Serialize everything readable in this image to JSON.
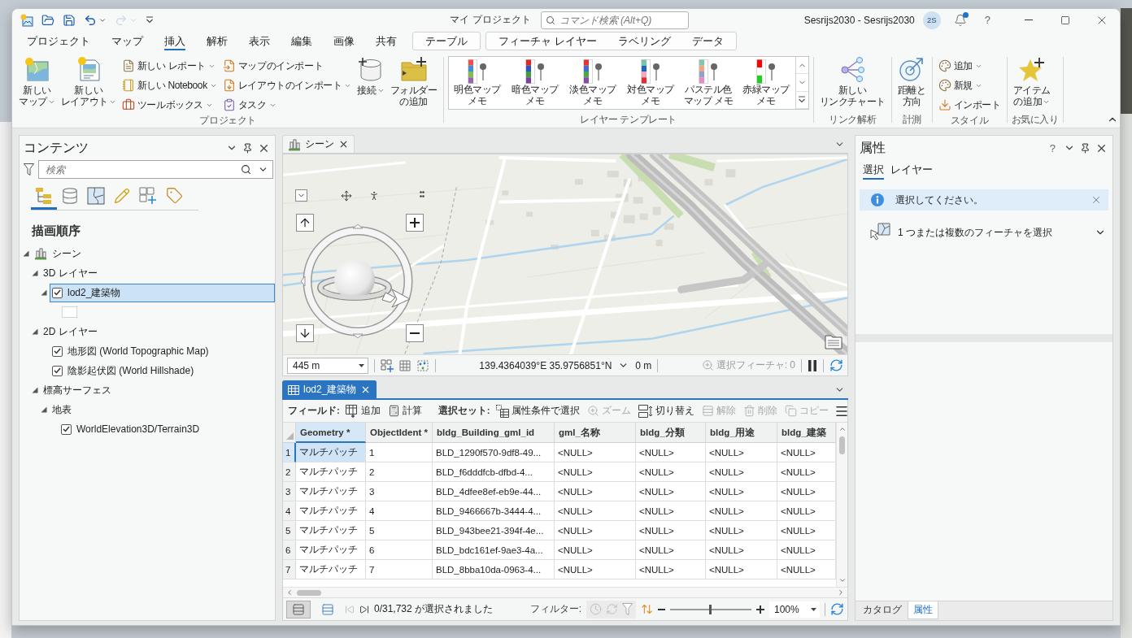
{
  "title_bar": {
    "quick_access": [
      {
        "kind": "new",
        "disabled": false
      },
      {
        "kind": "open",
        "disabled": false
      },
      {
        "kind": "save",
        "disabled": false
      },
      {
        "kind": "undo",
        "disabled": false
      },
      {
        "kind": "redo",
        "disabled": true
      },
      {
        "kind": "customize",
        "disabled": false
      }
    ],
    "title": "マイ プロジェクト",
    "command_search": {
      "placeholder": "コマンド検索 (Alt+Q)"
    },
    "user": "Sesrijs2030 - Sesrijs2030",
    "avatar": "2S",
    "notification_dot": true,
    "help": "?"
  },
  "ribbon": {
    "tabs": [
      {
        "label": "プロジェクト",
        "selected": false
      },
      {
        "label": "マップ",
        "selected": false
      },
      {
        "label": "挿入",
        "selected": true
      },
      {
        "label": "解析",
        "selected": false
      },
      {
        "label": "表示",
        "selected": false
      },
      {
        "label": "編集",
        "selected": false
      },
      {
        "label": "画像",
        "selected": false
      },
      {
        "label": "共有",
        "selected": false
      }
    ],
    "context_tabs": [
      {
        "tabs": [
          {
            "label": "テーブル",
            "selected": false
          }
        ]
      },
      {
        "tabs": [
          {
            "label": "フィーチャ レイヤー",
            "selected": false
          },
          {
            "label": "ラベリング",
            "selected": false
          },
          {
            "label": "データ",
            "selected": false
          }
        ]
      }
    ],
    "groups": [
      {
        "label": "プロジェクト",
        "controls": [
          {
            "kind": "large",
            "lines": [
              "新しい",
              "マップ"
            ],
            "dropdown": true
          },
          {
            "kind": "large",
            "lines": [
              "新しい",
              "レイアウト"
            ],
            "dropdown": true
          },
          {
            "kind": "stack",
            "buttons": [
              {
                "label": "新しい レポート",
                "dropdown": true
              },
              {
                "label": "新しい Notebook",
                "dropdown": true
              },
              {
                "label": "ツールボックス",
                "dropdown": true
              }
            ]
          },
          {
            "kind": "stack",
            "buttons": [
              {
                "label": "マップのインポート",
                "dropdown": false
              },
              {
                "label": "レイアウトのインポート",
                "dropdown": true
              },
              {
                "label": "タスク",
                "dropdown": true
              }
            ]
          },
          {
            "kind": "large",
            "lines": [
              "接続"
            ],
            "dropdown": true
          },
          {
            "kind": "large",
            "lines": [
              "フォルダー",
              "の追加"
            ],
            "dropdown": false
          }
        ]
      },
      {
        "label": "レイヤー テンプレート",
        "controls": [
          {
            "kind": "gallery",
            "items": [
              {
                "lines": [
                  "明色マップ",
                  "メモ"
                ]
              },
              {
                "lines": [
                  "暗色マップ",
                  "メモ"
                ]
              },
              {
                "lines": [
                  "淡色マップ",
                  "メモ"
                ]
              },
              {
                "lines": [
                  "対色マップ",
                  "メモ"
                ]
              },
              {
                "lines": [
                  "パステル色",
                  "マップ メモ"
                ]
              },
              {
                "lines": [
                  "赤緑マップ",
                  "メモ"
                ]
              }
            ]
          }
        ]
      },
      {
        "label": "リンク解析",
        "controls": [
          {
            "kind": "large",
            "lines": [
              "新しい",
              "リンクチャート"
            ],
            "dropdown": false
          }
        ]
      },
      {
        "label": "計測",
        "controls": [
          {
            "kind": "large",
            "lines": [
              "距離と",
              "方向"
            ],
            "dropdown": false
          }
        ]
      },
      {
        "label": "スタイル",
        "controls": [
          {
            "kind": "stack",
            "buttons": [
              {
                "label": "追加",
                "dropdown": true
              },
              {
                "label": "新規",
                "dropdown": true
              },
              {
                "label": "インポート",
                "dropdown": false
              }
            ]
          }
        ]
      },
      {
        "label": "お気に入り",
        "controls": [
          {
            "kind": "large",
            "lines": [
              "アイテム",
              "の追加"
            ],
            "dropdown": true
          }
        ]
      }
    ]
  },
  "contents_pane": {
    "title": "コンテンツ",
    "search": {
      "placeholder": "検索"
    },
    "view_tabs": [
      {
        "selected": true
      },
      {
        "selected": false
      },
      {
        "selected": false
      },
      {
        "selected": false
      },
      {
        "selected": false
      },
      {
        "selected": false
      }
    ],
    "heading": "描画順序",
    "tree": [
      {
        "kind": "scene",
        "label": "シーン",
        "expanded": true,
        "selected": false,
        "children": [
          {
            "kind": "group",
            "label": "3D レイヤー",
            "expanded": true,
            "selected": false,
            "children": [
              {
                "kind": "layer",
                "label": "lod2_建築物",
                "expanded": true,
                "checked": true,
                "selected": true,
                "children": [
                  {
                    "kind": "symbol",
                    "selected": false
                  }
                ]
              }
            ]
          },
          {
            "kind": "group",
            "label": "2D レイヤー",
            "expanded": true,
            "selected": false,
            "children": [
              {
                "kind": "layer",
                "label": "地形図 (World Topographic Map)",
                "checked": true,
                "selected": false
              },
              {
                "kind": "layer",
                "label": "陰影起伏図 (World Hillshade)",
                "checked": true,
                "selected": false
              }
            ]
          },
          {
            "kind": "group",
            "label": "標高サーフェス",
            "expanded": true,
            "selected": false,
            "children": [
              {
                "kind": "group",
                "label": "地表",
                "expanded": true,
                "selected": false,
                "children": [
                  {
                    "kind": "layer",
                    "label": "WorldElevation3D/Terrain3D",
                    "checked": true,
                    "selected": false
                  }
                ]
              }
            ]
          }
        ]
      }
    ]
  },
  "scene_view": {
    "active": false,
    "tab": {
      "label": "シーン",
      "selected": true
    },
    "scale": "445 m",
    "coordinates": "139.4364039°E 35.9756851°N",
    "elevation": "0 m",
    "selected_features": "選択フィーチャ: 0"
  },
  "table_view": {
    "active": true,
    "tab": {
      "label": "lod2_建築物",
      "selected": true
    },
    "toolbar": [
      {
        "kind": "label",
        "text": "フィールド:"
      },
      {
        "kind": "button",
        "label": "追加",
        "disabled": false
      },
      {
        "kind": "button",
        "label": "計算",
        "disabled": false
      },
      {
        "kind": "separator"
      },
      {
        "kind": "label",
        "text": "選択セット:"
      },
      {
        "kind": "button",
        "label": "属性条件で選択",
        "disabled": false
      },
      {
        "kind": "button",
        "label": "ズーム",
        "disabled": true
      },
      {
        "kind": "button",
        "label": "切り替え",
        "disabled": false
      },
      {
        "kind": "button",
        "label": "解除",
        "disabled": true
      },
      {
        "kind": "button",
        "label": "削除",
        "disabled": true
      },
      {
        "kind": "button",
        "label": "コピー",
        "disabled": true
      }
    ],
    "columns": [
      {
        "label": "Geometry *",
        "current": true
      },
      {
        "label": "ObjectIdent *",
        "current": false
      },
      {
        "label": "bldg_Building_gml_id",
        "current": false
      },
      {
        "label": "gml_名称",
        "current": false
      },
      {
        "label": "bldg_分類",
        "current": false
      },
      {
        "label": "bldg_用途",
        "current": false
      },
      {
        "label": "bldg_建築",
        "current": false
      }
    ],
    "rows": [
      {
        "number": "1",
        "current": true,
        "selected": false,
        "cells": [
          "マルチパッチ",
          "1",
          "BLD_1290f570-9df8-49...",
          "<NULL>",
          "<NULL>",
          "<NULL>",
          "<NULL>"
        ]
      },
      {
        "number": "2",
        "current": false,
        "selected": false,
        "cells": [
          "マルチパッチ",
          "2",
          "BLD_f6dddfcb-dfbd-4...",
          "<NULL>",
          "<NULL>",
          "<NULL>",
          "<NULL>"
        ]
      },
      {
        "number": "3",
        "current": false,
        "selected": false,
        "cells": [
          "マルチパッチ",
          "3",
          "BLD_4dfee8ef-eb9e-44...",
          "<NULL>",
          "<NULL>",
          "<NULL>",
          "<NULL>"
        ]
      },
      {
        "number": "4",
        "current": false,
        "selected": false,
        "cells": [
          "マルチパッチ",
          "4",
          "BLD_9466667b-3444-4...",
          "<NULL>",
          "<NULL>",
          "<NULL>",
          "<NULL>"
        ]
      },
      {
        "number": "5",
        "current": false,
        "selected": false,
        "cells": [
          "マルチパッチ",
          "5",
          "BLD_943bee21-394f-4e...",
          "<NULL>",
          "<NULL>",
          "<NULL>",
          "<NULL>"
        ]
      },
      {
        "number": "6",
        "current": false,
        "selected": false,
        "cells": [
          "マルチパッチ",
          "6",
          "BLD_bdc161ef-9ae3-4a...",
          "<NULL>",
          "<NULL>",
          "<NULL>",
          "<NULL>"
        ]
      },
      {
        "number": "7",
        "current": false,
        "selected": false,
        "cells": [
          "マルチパッチ",
          "7",
          "BLD_8bba10da-0963-4...",
          "<NULL>",
          "<NULL>",
          "<NULL>",
          "<NULL>"
        ]
      }
    ],
    "record_views": [
      {
        "selected": true
      },
      {
        "selected": false
      }
    ],
    "selection_status": "0/31,732 が選択されました",
    "filter_label": "フィルター:",
    "zoom": {
      "level": 0.49,
      "reading": "100%"
    }
  },
  "properties_pane": {
    "title": "属性",
    "help": "?",
    "tabs": [
      {
        "label": "選択",
        "selected": true
      },
      {
        "label": "レイヤー",
        "selected": false
      }
    ],
    "message": "選択してください。",
    "hint": "1 つまたは複数のフィーチャを選択",
    "hint_expanded": false,
    "bottom_tabs": [
      {
        "label": "カタログ",
        "selected": false
      },
      {
        "label": "属性",
        "selected": true
      }
    ]
  }
}
